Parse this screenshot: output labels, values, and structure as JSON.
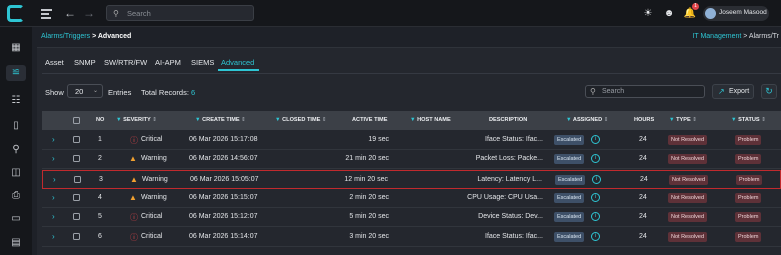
{
  "topbar": {
    "search_placeholder": "Search",
    "notification_count": "1",
    "user_name": "Joseem Masood",
    "back_icon": "arrow-left-icon",
    "forward_icon": "arrow-right-icon"
  },
  "breadcrumb": {
    "parent": "Alarms/Triggers",
    "sep": " > ",
    "current": "Advanced"
  },
  "breadcrumb_right": {
    "root": "IT Management",
    "rest": " > Alarms/Tr"
  },
  "tabs": [
    "Asset",
    "SNMP",
    "SW/RTR/FW",
    "AI-APM",
    "SIEMS",
    "Advanced"
  ],
  "controls": {
    "show_label": "Show",
    "page_size": "20",
    "entries_label": "Entries",
    "total_label": "Total Records:",
    "total_value": "6",
    "search_placeholder": "Search",
    "export_label": "Export"
  },
  "columns": [
    "NO",
    "SEVERITY",
    "CREATE TIME",
    "CLOSED TIME",
    "ACTIVE TIME",
    "HOST NAME",
    "DESCRIPTION",
    "ASSIGNED",
    "HOURS",
    "TYPE",
    "STATUS"
  ],
  "rows": [
    {
      "no": "1",
      "severity": "Critical",
      "create_time": "06 Mar 2026 15:17:08",
      "active_time": "19 sec",
      "description": "Iface Status: Ifac...",
      "assigned": "Escalated",
      "hours": "24",
      "type": "Not Resolved",
      "status": "Problem"
    },
    {
      "no": "2",
      "severity": "Warning",
      "create_time": "06 Mar 2026 14:56:07",
      "active_time": "21 min 20 sec",
      "description": "Packet Loss: Packe...",
      "assigned": "Escalated",
      "hours": "24",
      "type": "Not Resolved",
      "status": "Problem"
    },
    {
      "no": "3",
      "severity": "Warning",
      "create_time": "06 Mar 2026 15:05:07",
      "active_time": "12 min 20 sec",
      "description": "Latency: Latency L...",
      "assigned": "Escalated",
      "hours": "24",
      "type": "Not Resolved",
      "status": "Problem"
    },
    {
      "no": "4",
      "severity": "Warning",
      "create_time": "06 Mar 2026 15:15:07",
      "active_time": "2 min 20 sec",
      "description": "CPU Usage: CPU Usa...",
      "assigned": "Escalated",
      "hours": "24",
      "type": "Not Resolved",
      "status": "Problem"
    },
    {
      "no": "5",
      "severity": "Critical",
      "create_time": "06 Mar 2026 15:12:07",
      "active_time": "5 min 20 sec",
      "description": "Device Status: Dev...",
      "assigned": "Escalated",
      "hours": "24",
      "type": "Not Resolved",
      "status": "Problem"
    },
    {
      "no": "6",
      "severity": "Critical",
      "create_time": "06 Mar 2026 15:14:07",
      "active_time": "3 min 20 sec",
      "description": "Iface Status: Ifac...",
      "assigned": "Escalated",
      "hours": "24",
      "type": "Not Resolved",
      "status": "Problem"
    }
  ],
  "colors": {
    "accent": "#2ec5d3",
    "critical": "#e0454a",
    "warning": "#f0a030",
    "highlight_border": "#c02a2e"
  }
}
